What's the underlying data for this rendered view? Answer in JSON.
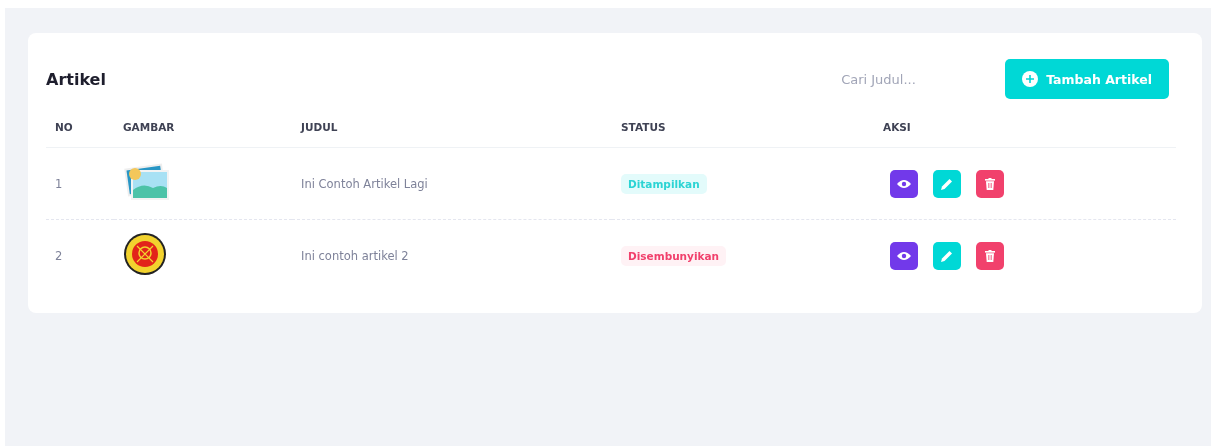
{
  "card": {
    "title": "Artikel",
    "search": {
      "placeholder": "Cari Judul..."
    },
    "add_button": {
      "label": "Tambah Artikel"
    }
  },
  "table": {
    "columns": [
      "NO",
      "GAMBAR",
      "JUDUL",
      "STATUS",
      "AKSI"
    ],
    "rows": [
      {
        "no": "1",
        "image": {
          "kind": "placeholder"
        },
        "title": "Ini Contoh Artikel Lagi",
        "status": {
          "label": "Ditampilkan",
          "kind": "shown"
        }
      },
      {
        "no": "2",
        "image": {
          "kind": "emblem"
        },
        "title": "Ini contoh artikel 2",
        "status": {
          "label": "Disembunyikan",
          "kind": "hidden"
        }
      }
    ]
  }
}
